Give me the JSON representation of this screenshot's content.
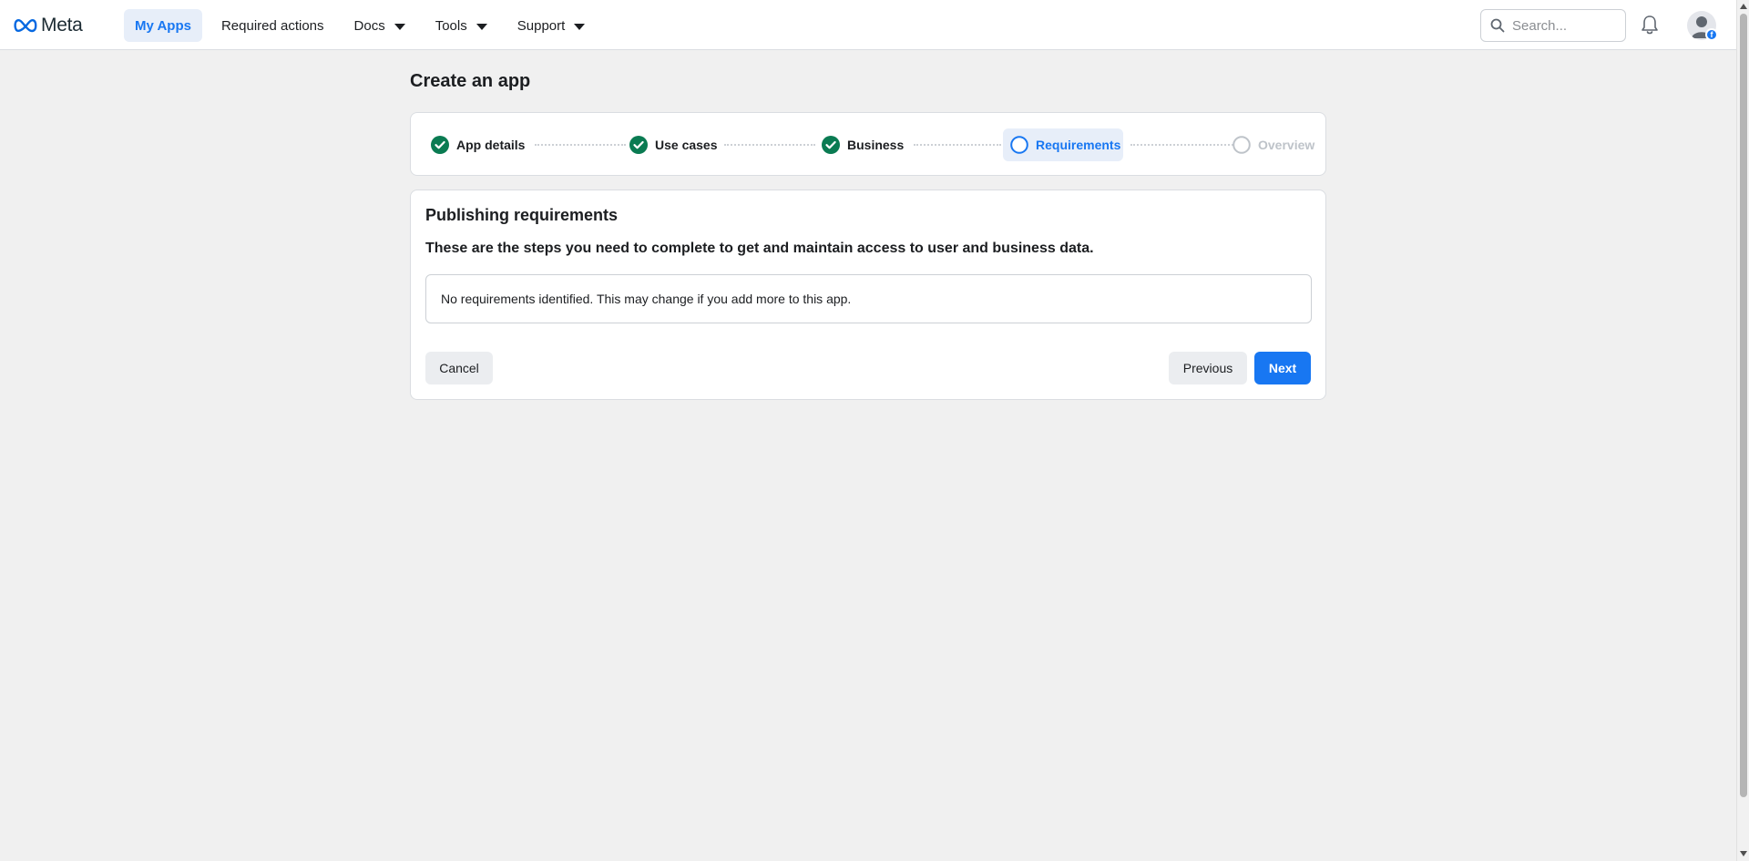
{
  "brand": {
    "name": "Meta",
    "accent": "#1877f2",
    "success": "#0a7b52"
  },
  "nav": {
    "items": [
      {
        "label": "My Apps",
        "active": true,
        "dropdown": false
      },
      {
        "label": "Required actions",
        "active": false,
        "dropdown": false
      },
      {
        "label": "Docs",
        "active": false,
        "dropdown": true
      },
      {
        "label": "Tools",
        "active": false,
        "dropdown": true
      },
      {
        "label": "Support",
        "active": false,
        "dropdown": true
      }
    ],
    "search": {
      "placeholder": "Search..."
    }
  },
  "page": {
    "title": "Create an app"
  },
  "stepper": {
    "steps": [
      {
        "label": "App details",
        "status": "complete"
      },
      {
        "label": "Use cases",
        "status": "complete"
      },
      {
        "label": "Business",
        "status": "complete"
      },
      {
        "label": "Requirements",
        "status": "current"
      },
      {
        "label": "Overview",
        "status": "pending"
      }
    ]
  },
  "content": {
    "title": "Publishing requirements",
    "subtitle": "These are the steps you need to complete to get and maintain access to user and business data.",
    "notice": "No requirements identified. This may change if you add more to this app."
  },
  "actions": {
    "cancel_label": "Cancel",
    "previous_label": "Previous",
    "next_label": "Next"
  }
}
